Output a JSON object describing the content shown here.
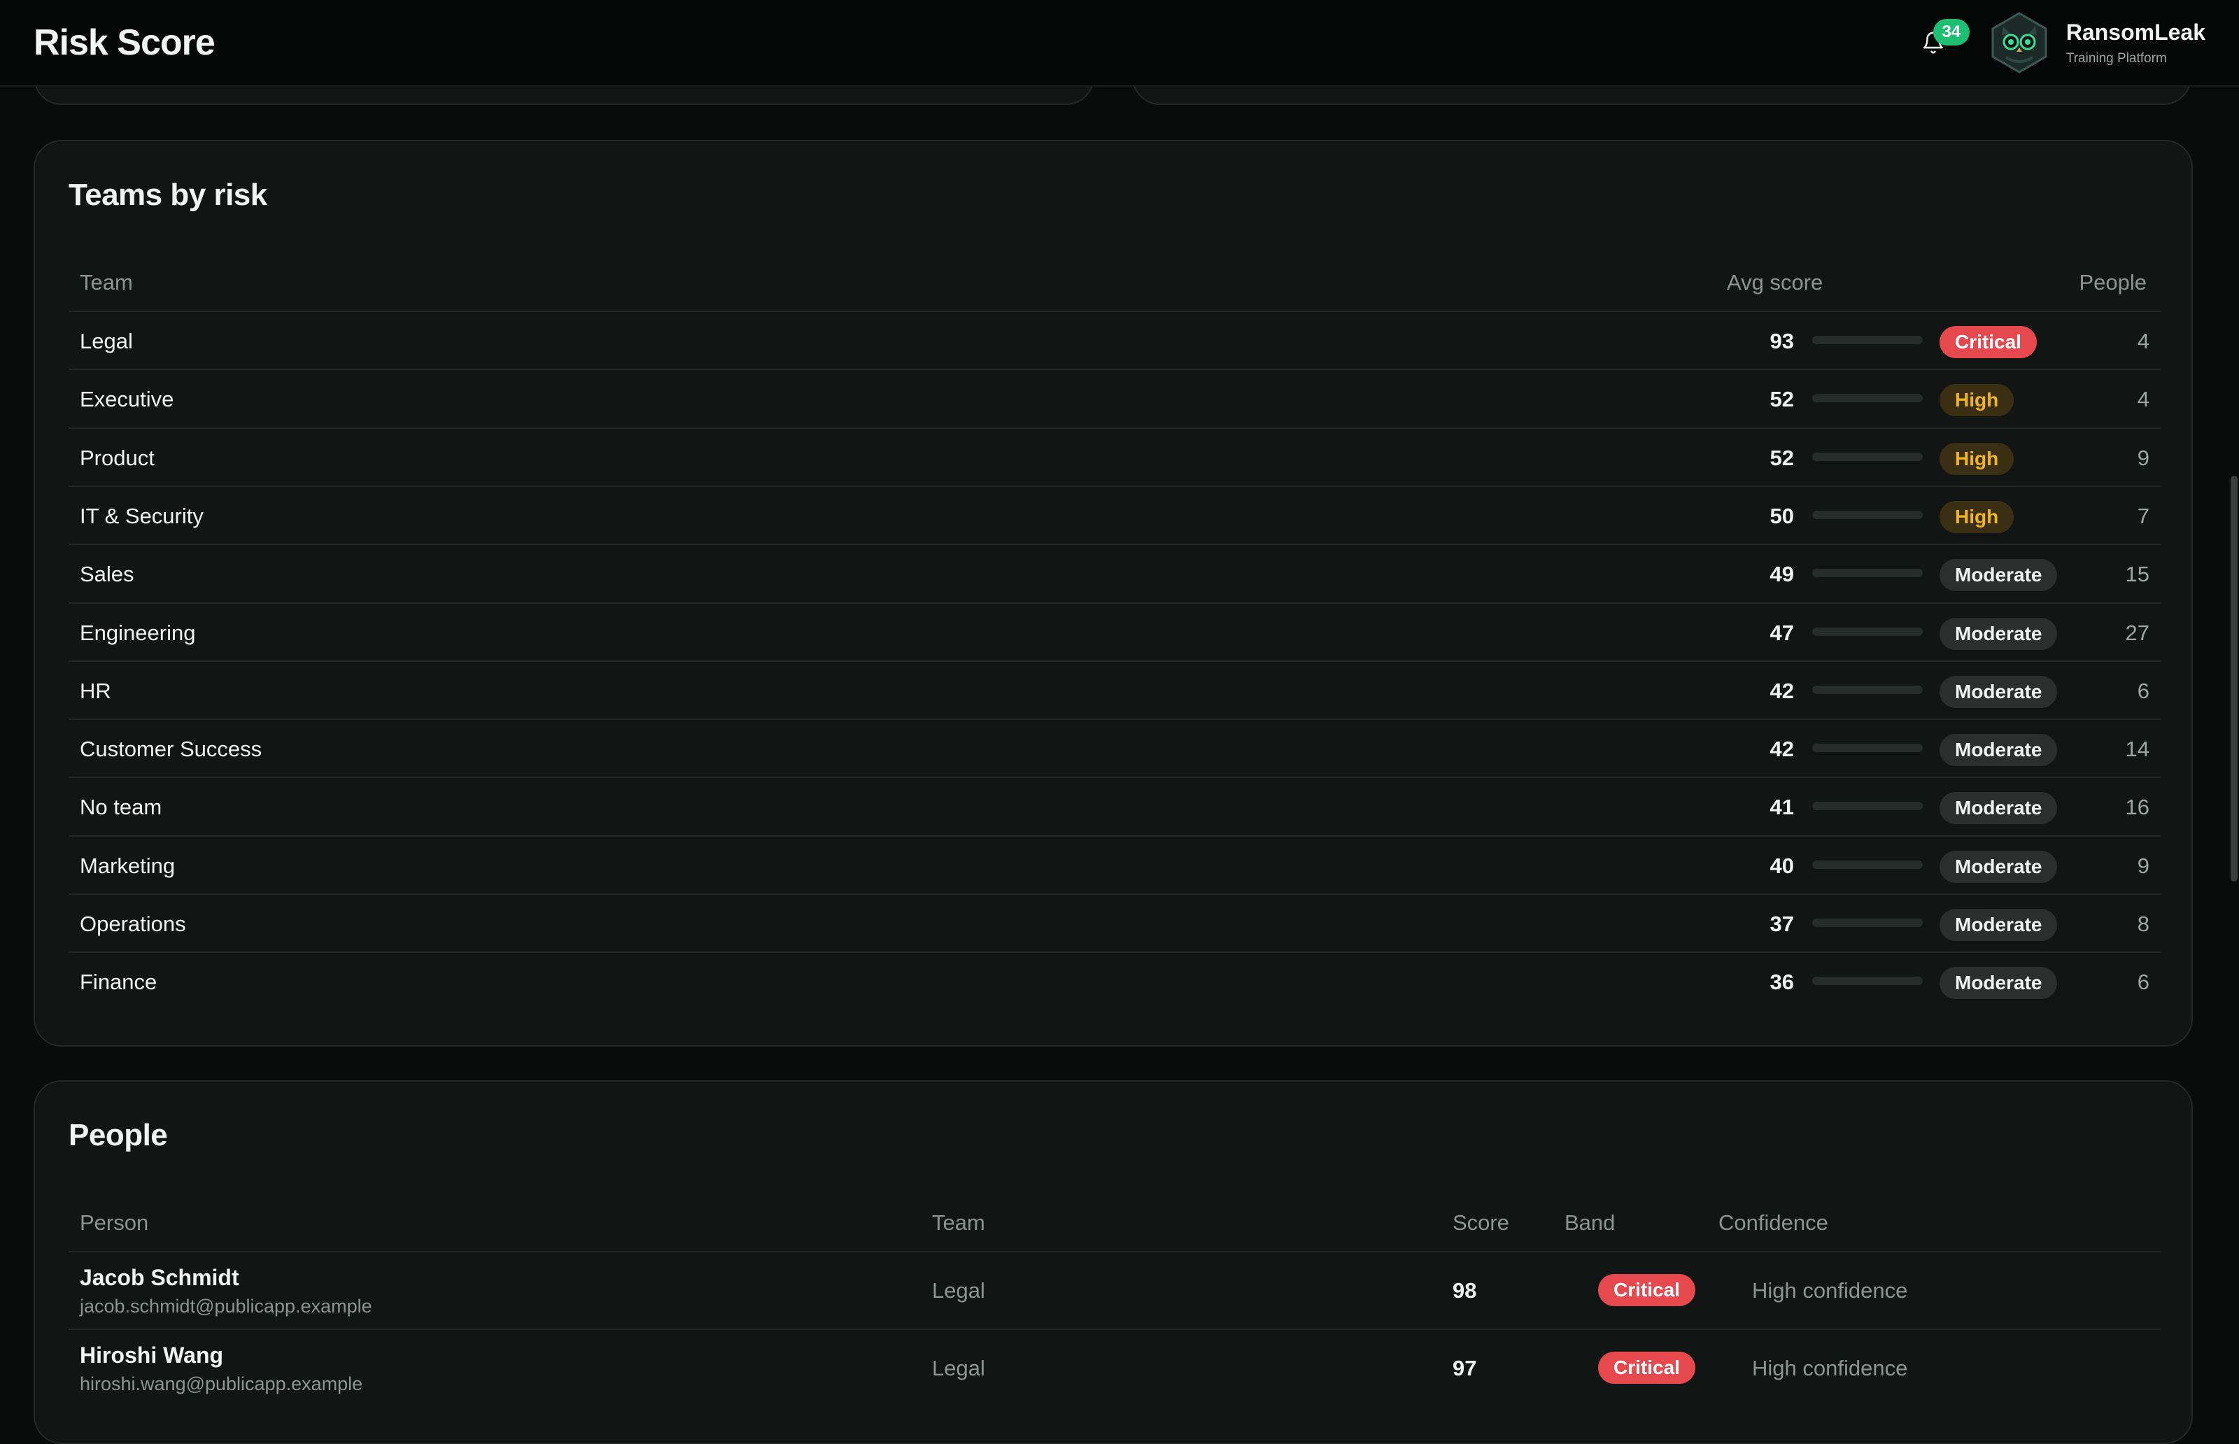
{
  "header": {
    "title": "Risk Score",
    "notification_icon": "bell-icon",
    "notification_count": "34",
    "brand": {
      "logo_icon": "owl-logo-icon",
      "name": "RansomLeak",
      "subtitle": "Training Platform"
    }
  },
  "colors": {
    "critical": "#e5484d",
    "high": "#f0b429",
    "moderate": "#a7adab",
    "accent_green": "#1fbf73"
  },
  "teams": {
    "title": "Teams by risk",
    "columns": {
      "team": "Team",
      "avg_score": "Avg score",
      "people": "People"
    },
    "rows": [
      {
        "team": "Legal",
        "score": "93",
        "score_value": 93,
        "band": "Critical",
        "band_type": "critical",
        "people": "4"
      },
      {
        "team": "Executive",
        "score": "52",
        "score_value": 52,
        "band": "High",
        "band_type": "high",
        "people": "4"
      },
      {
        "team": "Product",
        "score": "52",
        "score_value": 52,
        "band": "High",
        "band_type": "high",
        "people": "9"
      },
      {
        "team": "IT & Security",
        "score": "50",
        "score_value": 50,
        "band": "High",
        "band_type": "high",
        "people": "7"
      },
      {
        "team": "Sales",
        "score": "49",
        "score_value": 49,
        "band": "Moderate",
        "band_type": "moderate",
        "people": "15"
      },
      {
        "team": "Engineering",
        "score": "47",
        "score_value": 47,
        "band": "Moderate",
        "band_type": "moderate",
        "people": "27"
      },
      {
        "team": "HR",
        "score": "42",
        "score_value": 42,
        "band": "Moderate",
        "band_type": "moderate",
        "people": "6"
      },
      {
        "team": "Customer Success",
        "score": "42",
        "score_value": 42,
        "band": "Moderate",
        "band_type": "moderate",
        "people": "14"
      },
      {
        "team": "No team",
        "score": "41",
        "score_value": 41,
        "band": "Moderate",
        "band_type": "moderate",
        "people": "16"
      },
      {
        "team": "Marketing",
        "score": "40",
        "score_value": 40,
        "band": "Moderate",
        "band_type": "moderate",
        "people": "9"
      },
      {
        "team": "Operations",
        "score": "37",
        "score_value": 37,
        "band": "Moderate",
        "band_type": "moderate",
        "people": "8"
      },
      {
        "team": "Finance",
        "score": "36",
        "score_value": 36,
        "band": "Moderate",
        "band_type": "moderate",
        "people": "6"
      }
    ]
  },
  "people": {
    "title": "People",
    "columns": {
      "person": "Person",
      "team": "Team",
      "score": "Score",
      "band": "Band",
      "confidence": "Confidence"
    },
    "rows": [
      {
        "name": "Jacob Schmidt",
        "email": "jacob.schmidt@publicapp.example",
        "team": "Legal",
        "score": "98",
        "band": "Critical",
        "band_type": "critical",
        "confidence": "High confidence"
      },
      {
        "name": "Hiroshi Wang",
        "email": "hiroshi.wang@publicapp.example",
        "team": "Legal",
        "score": "97",
        "band": "Critical",
        "band_type": "critical",
        "confidence": "High confidence"
      }
    ]
  }
}
